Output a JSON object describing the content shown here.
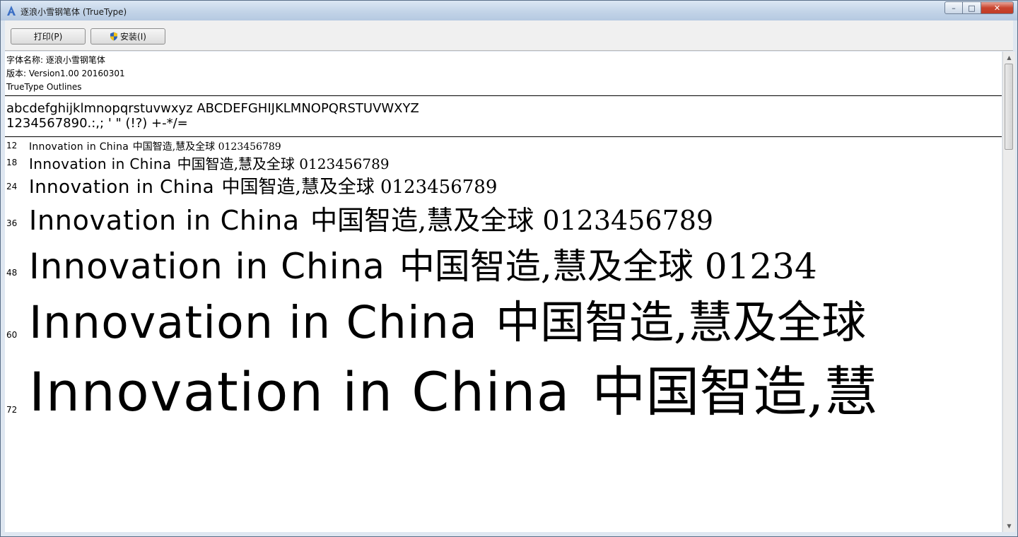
{
  "window": {
    "title": "逐浪小雪钢笔体 (TrueType)",
    "caption_minimize": "–",
    "caption_maximize": "□",
    "caption_close": "✕"
  },
  "toolbar": {
    "print_label": "打印(P)",
    "install_label": "安装(I)"
  },
  "font_info": {
    "name_line": "字体名称: 逐浪小雪钢笔体",
    "version_line": "版本: Version1.00 20160301",
    "outline_line": "TrueType Outlines"
  },
  "charset": {
    "line1": "abcdefghijklmnopqrstuvwxyz ABCDEFGHIJKLMNOPQRSTUVWXYZ",
    "line2": "1234567890.:,; ' \" (!?) +-*/="
  },
  "samples": [
    {
      "size": "12",
      "latin": "Innovation in China",
      "cjk": "中国智造,慧及全球 0123456789"
    },
    {
      "size": "18",
      "latin": "Innovation in China",
      "cjk": "中国智造,慧及全球 0123456789"
    },
    {
      "size": "24",
      "latin": "Innovation in China",
      "cjk": "中国智造,慧及全球 0123456789"
    },
    {
      "size": "36",
      "latin": "Innovation in China",
      "cjk": "中国智造,慧及全球 0123456789"
    },
    {
      "size": "48",
      "latin": "Innovation in China",
      "cjk": "中国智造,慧及全球 01234"
    },
    {
      "size": "60",
      "latin": "Innovation in China",
      "cjk": "中国智造,慧及全球"
    },
    {
      "size": "72",
      "latin": "Innovation in China",
      "cjk": "中国智造,慧"
    }
  ]
}
